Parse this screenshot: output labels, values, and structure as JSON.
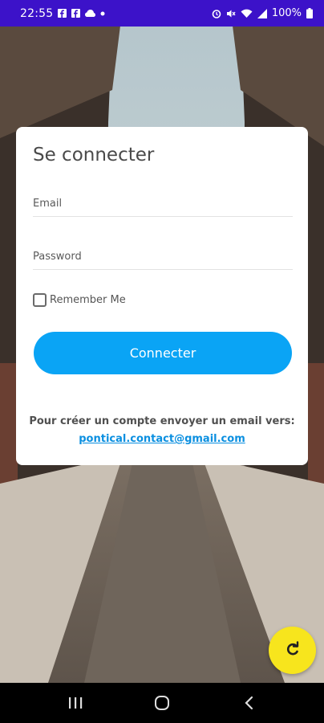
{
  "status_bar": {
    "time": "22:55",
    "battery": "100%",
    "left_icons": [
      "facebook-icon",
      "facebook-icon",
      "cloud-icon",
      "dot-icon"
    ],
    "right_icons": [
      "alarm-icon",
      "mute-icon",
      "wifi-icon",
      "signal-icon",
      "battery-icon"
    ]
  },
  "login": {
    "title": "Se connecter",
    "email_placeholder": "Email",
    "email_value": "",
    "password_placeholder": "Password",
    "password_value": "",
    "remember_label": "Remember Me",
    "remember_checked": false,
    "submit_label": "Connecter",
    "signup_text": "Pour créer un compte envoyer un email vers:",
    "signup_email": "pontical.contact@gmail.com"
  },
  "fab": {
    "icon": "refresh-icon",
    "color": "#f7e51d"
  },
  "nav_bar": {
    "buttons": [
      "recents-icon",
      "home-icon",
      "back-icon"
    ]
  },
  "colors": {
    "status_bar": "#3c12c9",
    "accent": "#0aa4f5",
    "link": "#0a8fe0"
  }
}
